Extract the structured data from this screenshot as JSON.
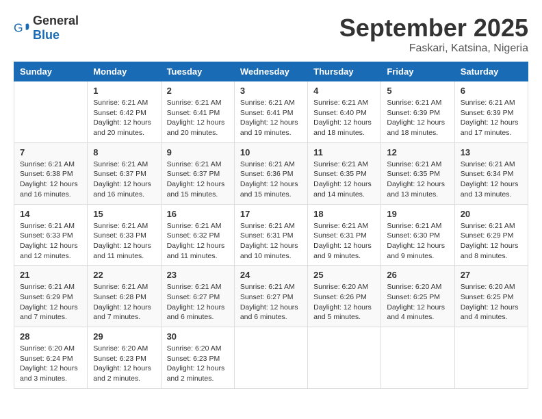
{
  "header": {
    "logo_general": "General",
    "logo_blue": "Blue",
    "month": "September 2025",
    "location": "Faskari, Katsina, Nigeria"
  },
  "weekdays": [
    "Sunday",
    "Monday",
    "Tuesday",
    "Wednesday",
    "Thursday",
    "Friday",
    "Saturday"
  ],
  "weeks": [
    [
      {
        "day": "",
        "info": ""
      },
      {
        "day": "1",
        "info": "Sunrise: 6:21 AM\nSunset: 6:42 PM\nDaylight: 12 hours\nand 20 minutes."
      },
      {
        "day": "2",
        "info": "Sunrise: 6:21 AM\nSunset: 6:41 PM\nDaylight: 12 hours\nand 20 minutes."
      },
      {
        "day": "3",
        "info": "Sunrise: 6:21 AM\nSunset: 6:41 PM\nDaylight: 12 hours\nand 19 minutes."
      },
      {
        "day": "4",
        "info": "Sunrise: 6:21 AM\nSunset: 6:40 PM\nDaylight: 12 hours\nand 18 minutes."
      },
      {
        "day": "5",
        "info": "Sunrise: 6:21 AM\nSunset: 6:39 PM\nDaylight: 12 hours\nand 18 minutes."
      },
      {
        "day": "6",
        "info": "Sunrise: 6:21 AM\nSunset: 6:39 PM\nDaylight: 12 hours\nand 17 minutes."
      }
    ],
    [
      {
        "day": "7",
        "info": "Sunrise: 6:21 AM\nSunset: 6:38 PM\nDaylight: 12 hours\nand 16 minutes."
      },
      {
        "day": "8",
        "info": "Sunrise: 6:21 AM\nSunset: 6:37 PM\nDaylight: 12 hours\nand 16 minutes."
      },
      {
        "day": "9",
        "info": "Sunrise: 6:21 AM\nSunset: 6:37 PM\nDaylight: 12 hours\nand 15 minutes."
      },
      {
        "day": "10",
        "info": "Sunrise: 6:21 AM\nSunset: 6:36 PM\nDaylight: 12 hours\nand 15 minutes."
      },
      {
        "day": "11",
        "info": "Sunrise: 6:21 AM\nSunset: 6:35 PM\nDaylight: 12 hours\nand 14 minutes."
      },
      {
        "day": "12",
        "info": "Sunrise: 6:21 AM\nSunset: 6:35 PM\nDaylight: 12 hours\nand 13 minutes."
      },
      {
        "day": "13",
        "info": "Sunrise: 6:21 AM\nSunset: 6:34 PM\nDaylight: 12 hours\nand 13 minutes."
      }
    ],
    [
      {
        "day": "14",
        "info": "Sunrise: 6:21 AM\nSunset: 6:33 PM\nDaylight: 12 hours\nand 12 minutes."
      },
      {
        "day": "15",
        "info": "Sunrise: 6:21 AM\nSunset: 6:33 PM\nDaylight: 12 hours\nand 11 minutes."
      },
      {
        "day": "16",
        "info": "Sunrise: 6:21 AM\nSunset: 6:32 PM\nDaylight: 12 hours\nand 11 minutes."
      },
      {
        "day": "17",
        "info": "Sunrise: 6:21 AM\nSunset: 6:31 PM\nDaylight: 12 hours\nand 10 minutes."
      },
      {
        "day": "18",
        "info": "Sunrise: 6:21 AM\nSunset: 6:31 PM\nDaylight: 12 hours\nand 9 minutes."
      },
      {
        "day": "19",
        "info": "Sunrise: 6:21 AM\nSunset: 6:30 PM\nDaylight: 12 hours\nand 9 minutes."
      },
      {
        "day": "20",
        "info": "Sunrise: 6:21 AM\nSunset: 6:29 PM\nDaylight: 12 hours\nand 8 minutes."
      }
    ],
    [
      {
        "day": "21",
        "info": "Sunrise: 6:21 AM\nSunset: 6:29 PM\nDaylight: 12 hours\nand 7 minutes."
      },
      {
        "day": "22",
        "info": "Sunrise: 6:21 AM\nSunset: 6:28 PM\nDaylight: 12 hours\nand 7 minutes."
      },
      {
        "day": "23",
        "info": "Sunrise: 6:21 AM\nSunset: 6:27 PM\nDaylight: 12 hours\nand 6 minutes."
      },
      {
        "day": "24",
        "info": "Sunrise: 6:21 AM\nSunset: 6:27 PM\nDaylight: 12 hours\nand 6 minutes."
      },
      {
        "day": "25",
        "info": "Sunrise: 6:20 AM\nSunset: 6:26 PM\nDaylight: 12 hours\nand 5 minutes."
      },
      {
        "day": "26",
        "info": "Sunrise: 6:20 AM\nSunset: 6:25 PM\nDaylight: 12 hours\nand 4 minutes."
      },
      {
        "day": "27",
        "info": "Sunrise: 6:20 AM\nSunset: 6:25 PM\nDaylight: 12 hours\nand 4 minutes."
      }
    ],
    [
      {
        "day": "28",
        "info": "Sunrise: 6:20 AM\nSunset: 6:24 PM\nDaylight: 12 hours\nand 3 minutes."
      },
      {
        "day": "29",
        "info": "Sunrise: 6:20 AM\nSunset: 6:23 PM\nDaylight: 12 hours\nand 2 minutes."
      },
      {
        "day": "30",
        "info": "Sunrise: 6:20 AM\nSunset: 6:23 PM\nDaylight: 12 hours\nand 2 minutes."
      },
      {
        "day": "",
        "info": ""
      },
      {
        "day": "",
        "info": ""
      },
      {
        "day": "",
        "info": ""
      },
      {
        "day": "",
        "info": ""
      }
    ]
  ]
}
